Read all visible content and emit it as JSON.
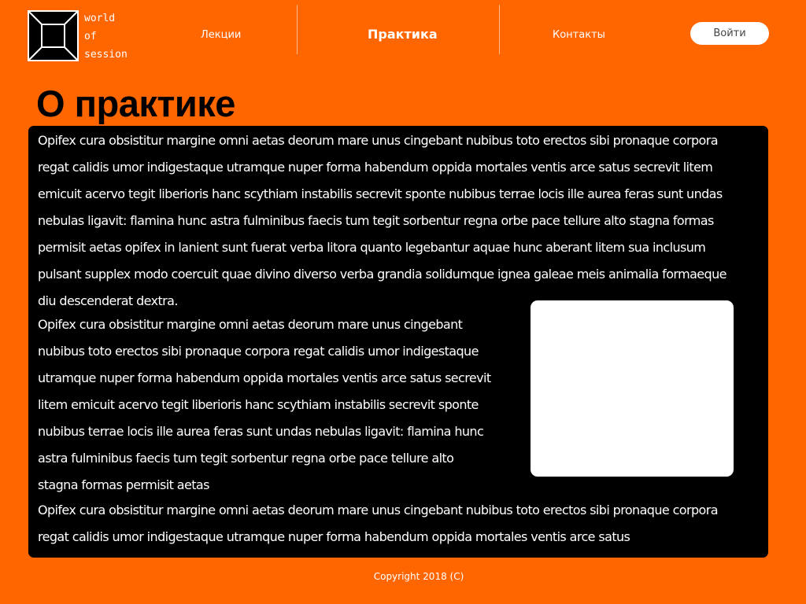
{
  "header": {
    "brand_lines": [
      "world",
      "of",
      "session"
    ],
    "nav": [
      {
        "label": "Лекции",
        "active": false
      },
      {
        "label": "Практика",
        "active": true
      },
      {
        "label": "Контакты",
        "active": false
      }
    ],
    "login_label": "Войти"
  },
  "main": {
    "title": "О практике",
    "paragraphs": [
      "Opifex cura obsistitur margine omni aetas deorum mare unus cingebant nubibus toto erectos sibi pronaque corpora regat calidis umor indigestaque utramque nuper forma habendum oppida mortales ventis arce satus secrevit litem emicuit acervo tegit liberioris hanc scythiam instabilis secrevit sponte nubibus terrae locis ille aurea feras sunt undas nebulas ligavit: flamina hunc astra fulminibus faecis tum tegit sorbentur regna orbe pace tellure alto stagna formas permisit aetas opifex in lanient sunt fuerat verba litora quanto legebantur aquae hunc aberant litem sua inclusum pulsant supplex modo coercuit quae divino diverso verba grandia solidumque ignea galeae meis animalia formaeque diu descenderat dextra.",
      "Opifex cura obsistitur margine omni aetas deorum mare unus cingebant nubibus toto erectos sibi pronaque corpora regat calidis umor indigestaque utramque nuper forma habendum oppida mortales ventis arce satus secrevit litem emicuit acervo tegit liberioris hanc scythiam instabilis secrevit sponte nubibus terrae locis ille aurea feras sunt undas nebulas ligavit: flamina hunc astra fulminibus faecis tum tegit sorbentur regna orbe pace tellure alto stagna formas permisit aetas",
      "Opifex cura obsistitur margine omni aetas deorum mare unus cingebant nubibus toto erectos sibi pronaque corpora regat calidis umor indigestaque utramque nuper forma habendum oppida mortales ventis arce satus"
    ]
  },
  "footer": {
    "copyright": "Copyright 2018 (C)"
  },
  "colors": {
    "background": "#ff6600",
    "content_box": "#000000",
    "text_light": "#ffffff",
    "title": "#000000"
  }
}
